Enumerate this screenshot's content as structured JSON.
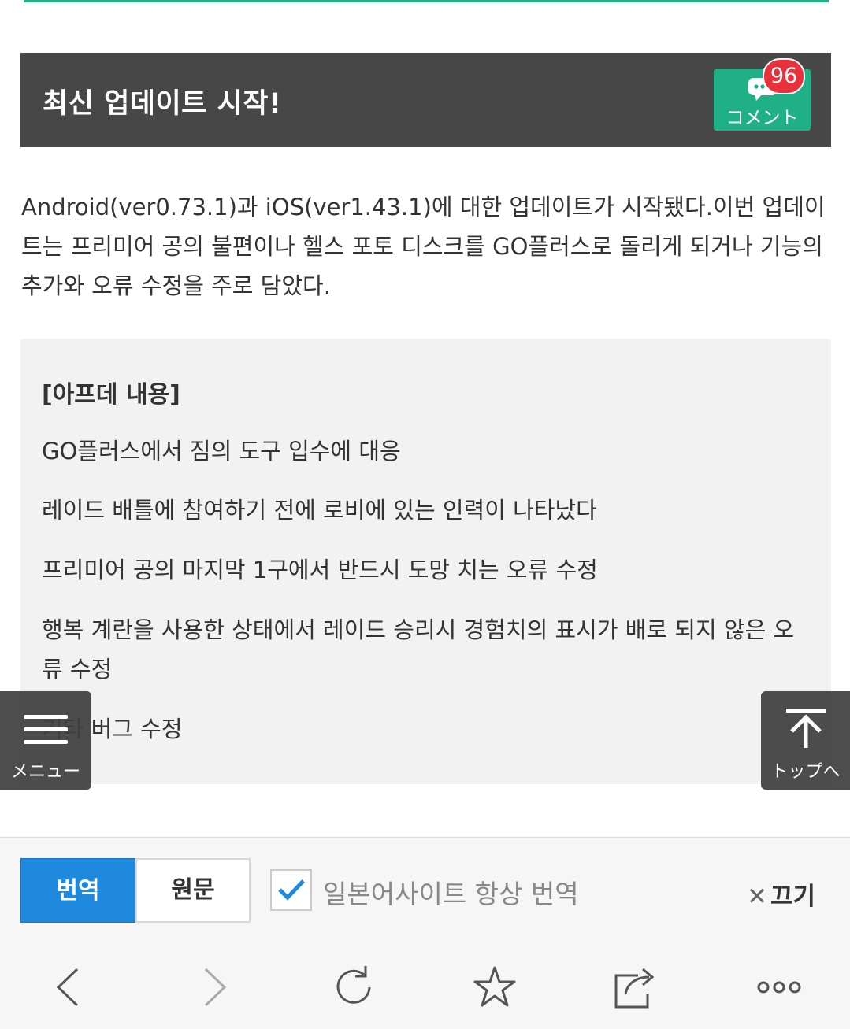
{
  "header": {
    "title": "최신 업데이트 시작!",
    "comment_label": "コメント",
    "comment_count": "96"
  },
  "article": {
    "intro": "Android(ver0.73.1)과 iOS(ver1.43.1)에 대한 업데이트가 시작됐다.이번 업데이트는 프리미어 공의 불편이나 헬스 포토 디스크를 GO플러스로 돌리게 되거나 기능의 추가와 오류 수정을 주로 담았다.",
    "patch_heading": "[아프데 내용]",
    "patch_items": [
      "GO플러스에서 짐의 도구 입수에 대응",
      "레이드 배틀에 참여하기 전에 로비에 있는 인력이 나타났다",
      "프리미어 공의 마지막 1구에서 반드시 도망 치는 오류 수정",
      "행복 계란을 사용한 상태에서 레이드 승리시 경험치의 표시가 배로 되지 않은 오류 수정",
      "기타 버그 수정"
    ]
  },
  "floating": {
    "menu_label": "メニュー",
    "top_label": "トップへ"
  },
  "translate_bar": {
    "translate_label": "번역",
    "original_label": "원문",
    "always_translate_label": "일본어사이트 항상 번역",
    "always_translate_checked": true,
    "close_label": "끄기"
  },
  "browser_nav": {
    "icons": [
      "back-icon",
      "forward-icon",
      "refresh-icon",
      "bookmark-star-icon",
      "share-icon",
      "more-icon"
    ]
  },
  "colors": {
    "header_bg": "#474747",
    "accent_green": "#20b085",
    "badge_red": "#e8313a",
    "translate_blue": "#1f89de"
  }
}
